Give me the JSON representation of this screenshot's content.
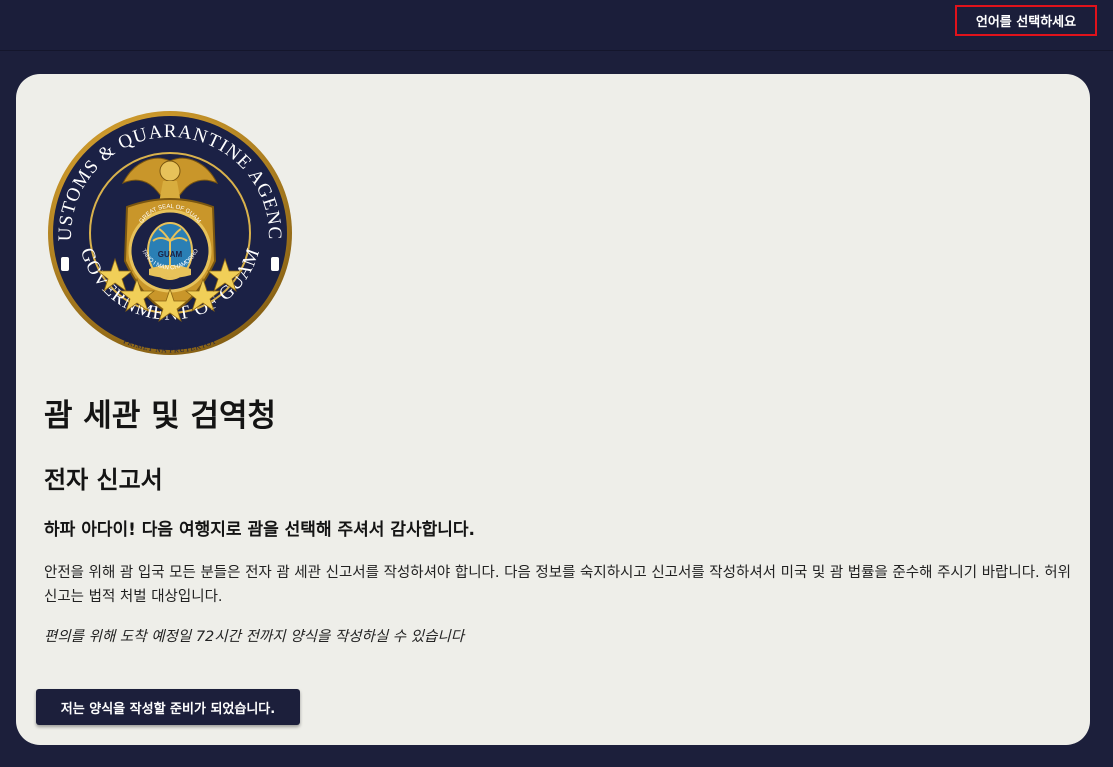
{
  "header": {
    "language_selector_label": "언어를 선택하세요"
  },
  "seal": {
    "ring_text_top": "CUSTOMS & QUARANTINE AGENCY",
    "ring_text_bottom": "GOVERNMENT OF GUAM",
    "motto": "PRIMET NA PRUTEKTOT",
    "inner_text_top": "GREAT SEAL OF GUAM",
    "inner_text_bottom": "TANO I MAN CHAMORRO",
    "inner_center": "GUAM"
  },
  "main": {
    "title": "괌 세관 및 검역청",
    "subtitle": "전자 신고서",
    "greeting": "하파 아다이! 다음 여행지로 괌을 선택해 주셔서 감사합니다.",
    "body": "안전을 위해 괌 입국 모든 분들은 전자 괌 세관 신고서를 작성하셔야 합니다. 다음 정보를 숙지하시고 신고서를 작성하셔서 미국 및 괌 법률을 준수해 주시기 바랍니다. 허위 신고는 법적 처벌 대상입니다.",
    "note": "편의를 위해 도착 예정일 72시간 전까지 양식을 작성하실 수 있습니다",
    "ready_button": "저는 양식을 작성할 준비가 되었습니다."
  },
  "colors": {
    "navy": "#1c1f3b",
    "card_bg": "#eeeee9",
    "gold": "#d4a62a",
    "highlight_border": "#e0121b"
  }
}
